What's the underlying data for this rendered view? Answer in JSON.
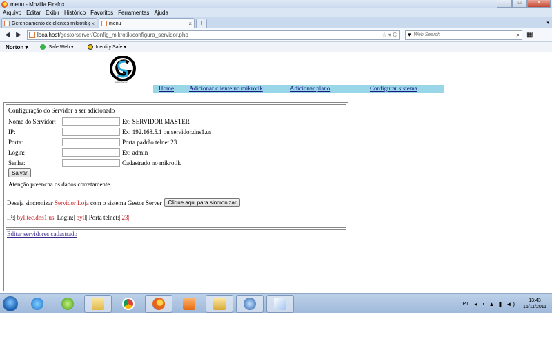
{
  "window": {
    "title": "menu - Mozilla Firefox",
    "controls": [
      "–",
      "□",
      "✕"
    ]
  },
  "menubar": {
    "items": [
      "Arquivo",
      "Editar",
      "Exibir",
      "Histórico",
      "Favoritos",
      "Ferramentas",
      "Ajuda"
    ]
  },
  "tabs": [
    {
      "label": "Gerenciamento de clientes mikrotik g...",
      "close": "×"
    },
    {
      "label": "menu",
      "close": "×"
    }
  ],
  "tabbar": {
    "new_tab": "+"
  },
  "navbar": {
    "back": "◀",
    "forward": "▶",
    "url_host": "localhost",
    "url_path": "/gestorserver/Config_mikrotik/configura_servidor.php",
    "url_controls": "☆ ▾ C",
    "search_placeholder": "Web Search",
    "search_prefix": "▾",
    "search_icon": "⌕",
    "bookmarks_icon": "▦"
  },
  "toolbar": {
    "norton": "Norton ▾",
    "safe_web": "Safe Web ▾",
    "identity_safe": "Identity Safe ▾",
    "colors": {
      "safe_web": "#3bb14a",
      "identity_safe": "#f2c400"
    }
  },
  "page": {
    "logo": {
      "caption": "Gestor Server"
    },
    "nav": {
      "home": "Home",
      "add_client": "Adicionar cliente no mikrotik",
      "add_plan": "Adicionar plano",
      "config_system": "Configurar sistema"
    },
    "form": {
      "heading": "Configuração do Servidor a ser adicionado",
      "fields": [
        {
          "label": "Nome do Servidor:",
          "value": "",
          "hint": "Ex: SERVIDOR MASTER"
        },
        {
          "label": "IP:",
          "value": "",
          "hint": "Ex: 192.168.5.1 ou servidor.dns1.us"
        },
        {
          "label": "Porta:",
          "value": "",
          "hint": "Porta padrão telnet 23"
        },
        {
          "label": "Login:",
          "value": "",
          "hint": "Ex: admin"
        },
        {
          "label": "Senha:",
          "value": "",
          "hint": "Cadastrado no mikrotik"
        }
      ],
      "save_label": "Salvar",
      "notice": "Atenção preencha os dados corretamente."
    },
    "sync": {
      "prefix": "Deseja sincronizar ",
      "server_name": "Servidor Loja",
      "suffix": " com o sistema Gestor Server",
      "button_label": "Clique aqui para sincronizar",
      "ip_label": "IP:|",
      "ip_value": " bylltec.dns1.us",
      "login_label": "| Login:|",
      "login_value": " byll",
      "port_label": "| Porta telnet:|",
      "port_value": " 23",
      "end": "|"
    },
    "edit_link": "Editar servidores cadastrado"
  },
  "taskbar": {
    "apps": [
      "internet-explorer",
      "dreamweaver",
      "file-explorer",
      "chrome",
      "firefox",
      "media-player",
      "folder",
      "thunderbird",
      "paint"
    ],
    "language": "PT",
    "tray_icons": "◂ ◔ ▲ ▮ ◄)",
    "time": "13:43",
    "date": "16/11/2011"
  }
}
